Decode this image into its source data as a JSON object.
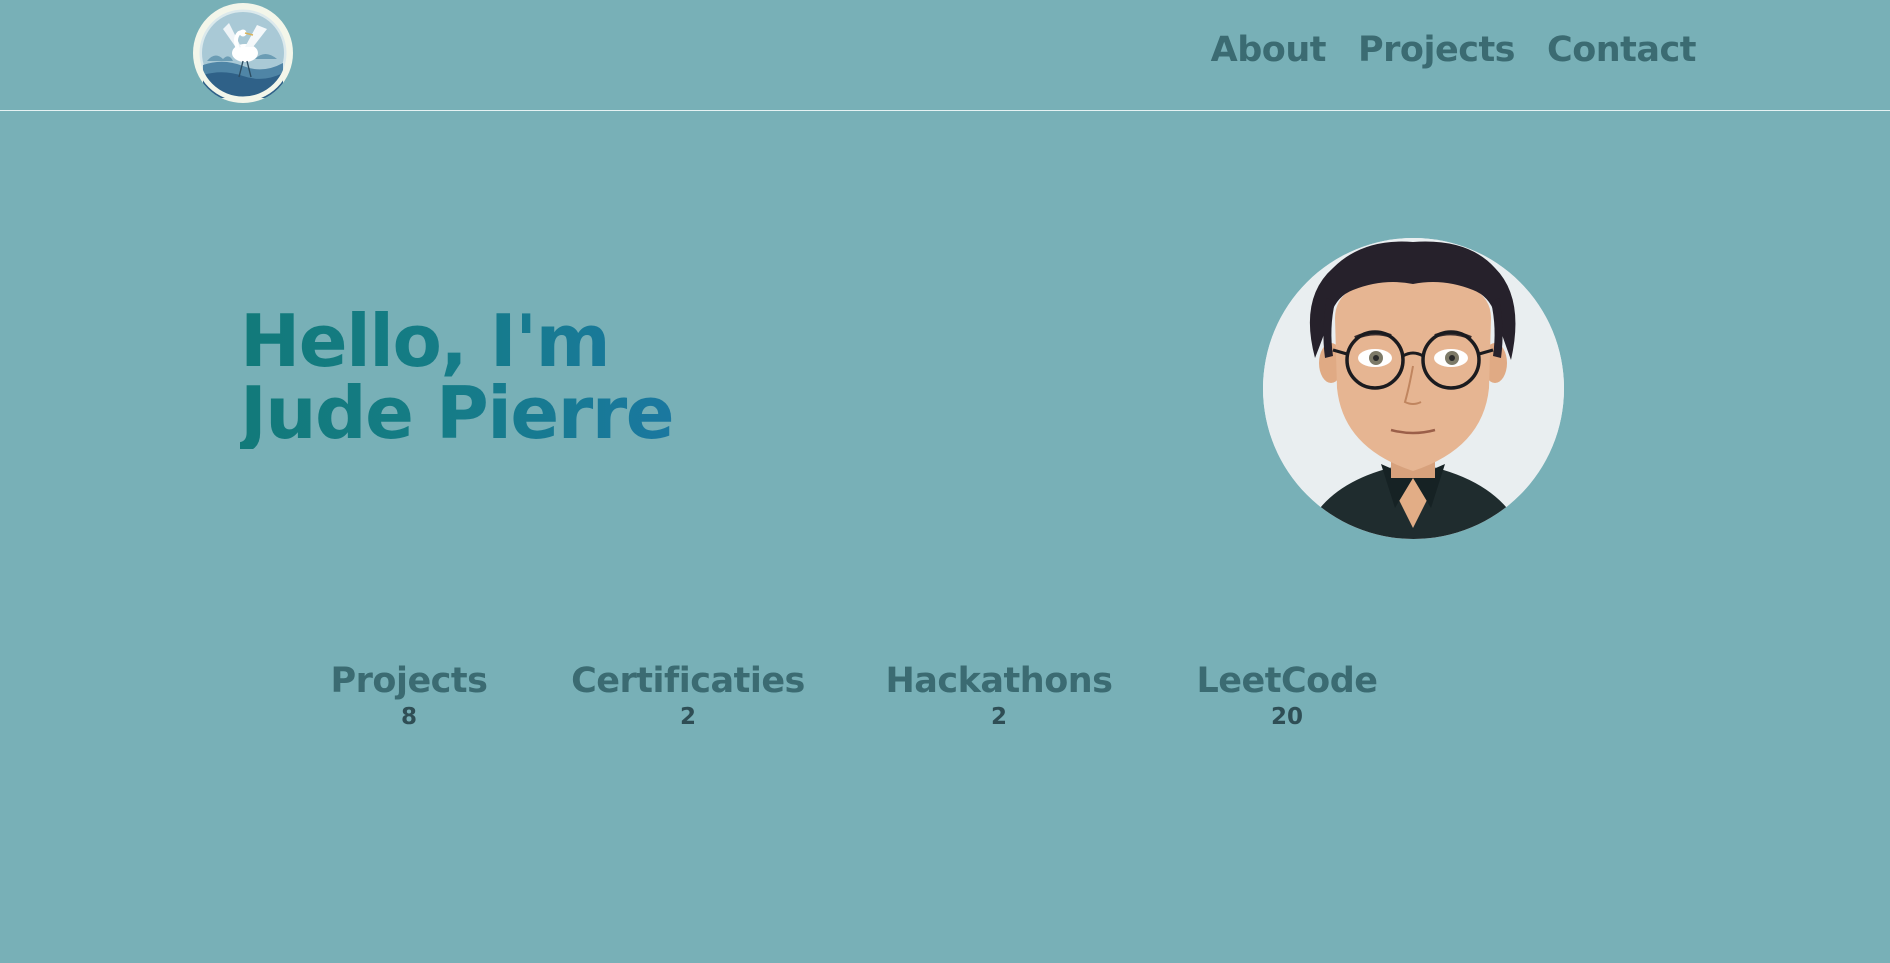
{
  "header": {
    "logo_icon": "egret-logo-icon",
    "nav": [
      {
        "label": "About"
      },
      {
        "label": "Projects"
      },
      {
        "label": "Contact"
      }
    ]
  },
  "hero": {
    "greeting": "Hello, I'm",
    "name": "Jude Pierre",
    "avatar_icon": "cartoon-avatar"
  },
  "stats": [
    {
      "label": "Projects",
      "value": "8"
    },
    {
      "label": "Certificaties",
      "value": "2"
    },
    {
      "label": "Hackathons",
      "value": "2"
    },
    {
      "label": "LeetCode",
      "value": "20"
    }
  ],
  "colors": {
    "background": "#78b0b7",
    "nav_text": "#3b6b72",
    "title_gradient_start": "#127a7a",
    "title_gradient_end": "#1a78a0",
    "stat_value": "#2f4e55"
  }
}
